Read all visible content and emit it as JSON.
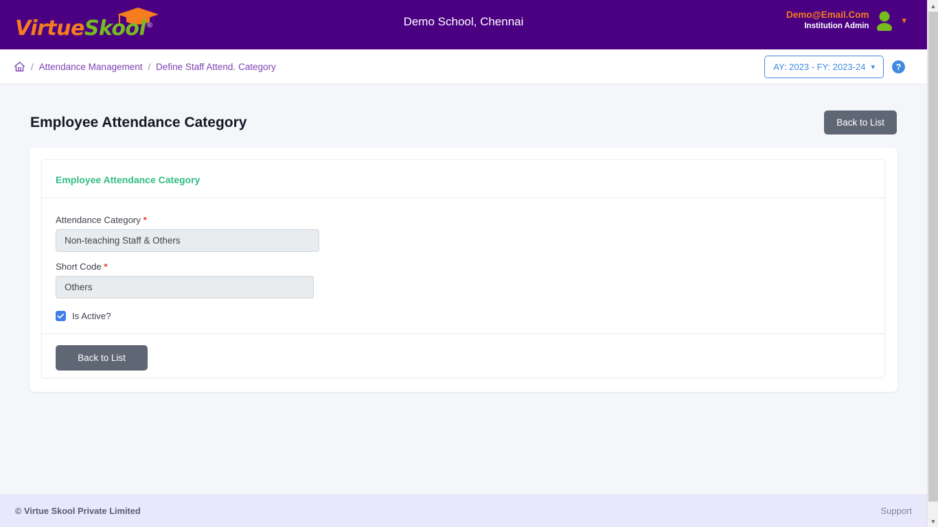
{
  "header": {
    "logo": {
      "part1": "Virtue",
      "part2": "Skool",
      "registered": "®",
      "cap_icon": "graduation-cap-icon"
    },
    "school_title": "Demo School, Chennai",
    "user": {
      "email": "Demo@Email.Com",
      "role": "Institution Admin",
      "avatar_icon": "user-avatar-icon",
      "caret_icon": "chevron-down-icon"
    },
    "colors": {
      "bar_bg": "#4b0082",
      "logo_orange": "#f57c1f",
      "logo_green": "#76bc21",
      "avatar_green": "#76bc21"
    }
  },
  "breadcrumb": {
    "home_icon": "home-icon",
    "separator": "/",
    "items": [
      {
        "label": "Attendance Management",
        "current": false
      },
      {
        "label": "Define Staff Attend. Category",
        "current": true
      }
    ],
    "year_selector": {
      "label": "AY: 2023 - FY: 2023-24",
      "caret_icon": "chevron-down-icon"
    },
    "help": {
      "icon": "help-question-icon",
      "glyph": "?"
    }
  },
  "page": {
    "title": "Employee Attendance Category",
    "back_to_list_top": "Back to List"
  },
  "card": {
    "title": "Employee Attendance Category",
    "title_color": "#2fbd85",
    "fields": [
      {
        "label": "Attendance Category",
        "required_mark": "*",
        "value": "Non-teaching Staff & Others",
        "placeholder": "Attendance Category"
      },
      {
        "label": "Short Code",
        "required_mark": "*",
        "value": "Others",
        "placeholder": "Short Code"
      }
    ],
    "checkbox": {
      "label": "Is Active?",
      "checked": true,
      "color": "#3f7fe8"
    },
    "back_to_list": "Back to List"
  },
  "footer": {
    "copyright": "© Virtue Skool Private Limited",
    "support": "Support"
  },
  "scrollbar": {
    "up_arrow": "▲",
    "down_arrow": "▼"
  }
}
